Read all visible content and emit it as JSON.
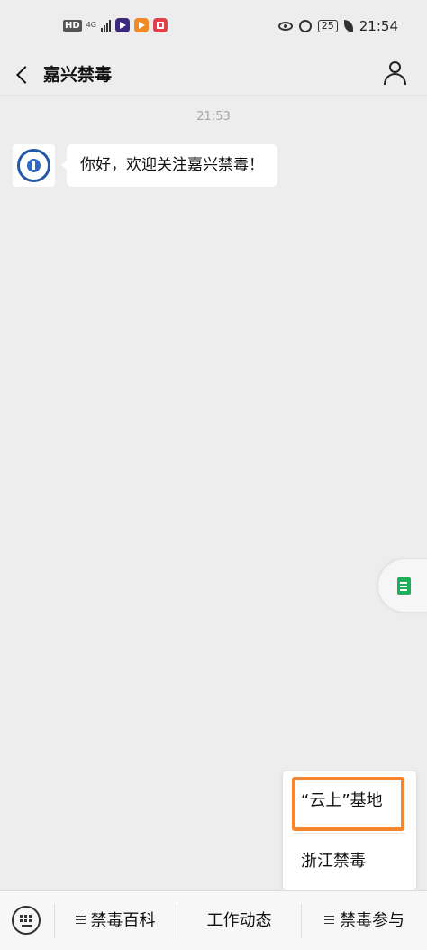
{
  "status_bar": {
    "hd_label": "HD",
    "network_label": "4G",
    "time": "21:54",
    "battery_level": "25",
    "icons": [
      "eye-icon",
      "alarm-icon",
      "battery-icon",
      "leaf-icon",
      "signal-icon"
    ]
  },
  "header": {
    "title": "嘉兴禁毒",
    "back_icon": "chevron-left-icon",
    "profile_icon": "user-icon"
  },
  "chat": {
    "timestamp": "21:53",
    "messages": [
      {
        "sender": "嘉兴禁毒",
        "text": "你好，欢迎关注嘉兴禁毒！"
      }
    ]
  },
  "submenu": {
    "items": [
      {
        "label": "“云上”基地",
        "highlighted": true
      },
      {
        "label": "浙江禁毒"
      }
    ],
    "highlight_color": "#f7852d"
  },
  "bottom_menu": {
    "keyboard_icon": "keyboard-icon",
    "items": [
      {
        "label": "禁毒百科",
        "has_submenu": true
      },
      {
        "label": "工作动态",
        "has_submenu": false
      },
      {
        "label": "禁毒参与",
        "has_submenu": true
      }
    ]
  },
  "side_tab": {
    "icon": "document-icon",
    "color": "#1fae5b"
  },
  "colors": {
    "background": "#ededed",
    "bubble": "#ffffff",
    "accent_green": "#1fae5b"
  }
}
